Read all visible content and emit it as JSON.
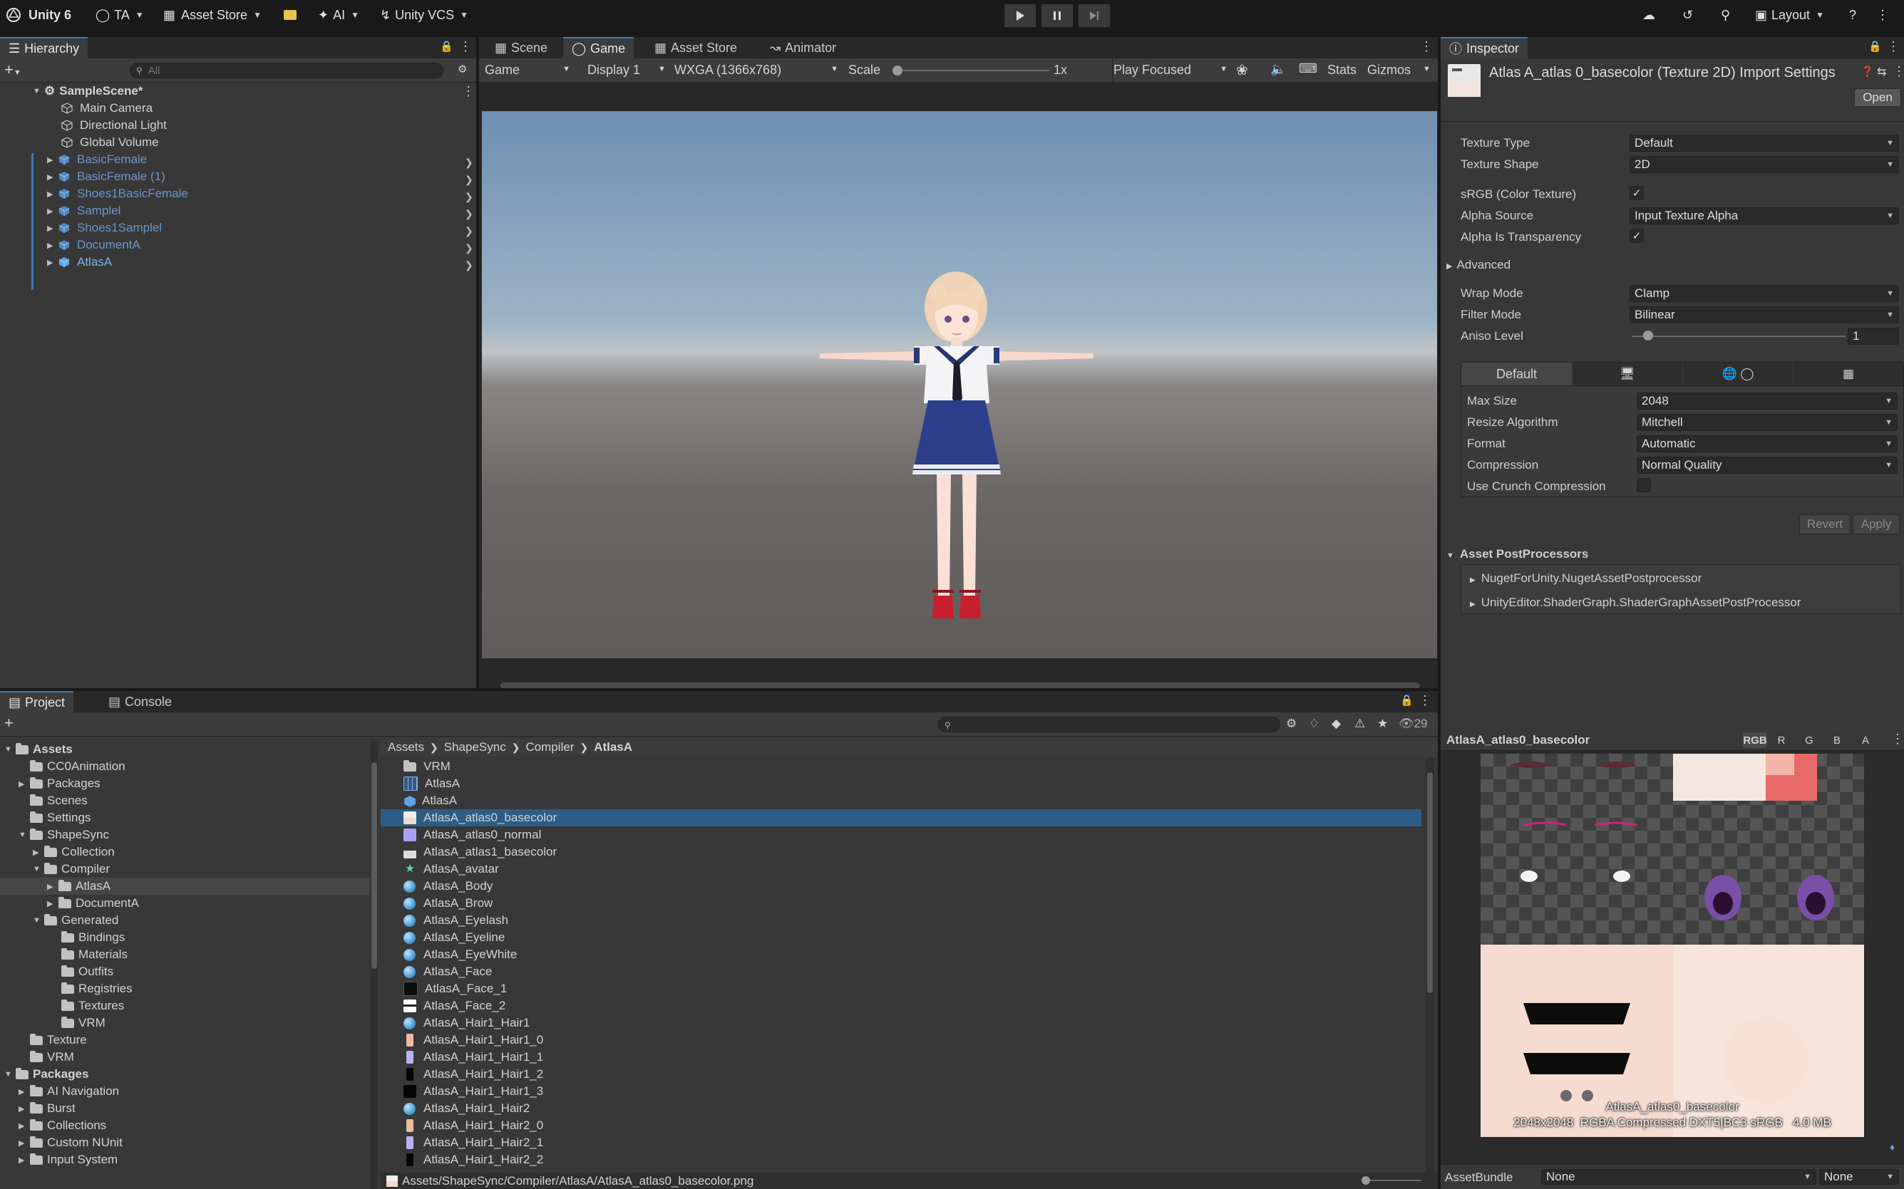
{
  "toolbar": {
    "app_name": "Unity 6",
    "account": "TA",
    "asset_store": "Asset Store",
    "ai": "AI",
    "vcs": "Unity VCS",
    "layout": "Layout"
  },
  "hierarchy": {
    "tab": "Hierarchy",
    "search_placeholder": "All",
    "scene": "SampleScene*",
    "items": [
      "Main Camera",
      "Directional Light",
      "Global Volume",
      "BasicFemale",
      "BasicFemale (1)",
      "Shoes1BasicFemale",
      "Samplel",
      "Shoes1Samplel",
      "DocumentA",
      "AtlasA"
    ]
  },
  "game_view": {
    "tabs": [
      "Scene",
      "Game",
      "Asset Store",
      "Animator"
    ],
    "view_mode": "Game",
    "display": "Display 1",
    "resolution": "WXGA (1366x768)",
    "scale_label": "Scale",
    "scale_value": "1x",
    "play_mode": "Play Focused",
    "stats": "Stats",
    "gizmos": "Gizmos"
  },
  "inspector": {
    "tab": "Inspector",
    "title": "Atlas A_atlas 0_basecolor (Texture 2D) Import Settings",
    "open_button": "Open",
    "fields": {
      "texture_type": {
        "label": "Texture Type",
        "value": "Default"
      },
      "texture_shape": {
        "label": "Texture Shape",
        "value": "2D"
      },
      "srgb": {
        "label": "sRGB (Color Texture)"
      },
      "alpha_source": {
        "label": "Alpha Source",
        "value": "Input Texture Alpha"
      },
      "alpha_transparency": {
        "label": "Alpha Is Transparency"
      },
      "advanced": "Advanced",
      "wrap_mode": {
        "label": "Wrap Mode",
        "value": "Clamp"
      },
      "filter_mode": {
        "label": "Filter Mode",
        "value": "Bilinear"
      },
      "aniso_level": {
        "label": "Aniso Level",
        "value": "1"
      }
    },
    "platform_tab": "Default",
    "platform": {
      "max_size": {
        "label": "Max Size",
        "value": "2048"
      },
      "resize": {
        "label": "Resize Algorithm",
        "value": "Mitchell"
      },
      "format": {
        "label": "Format",
        "value": "Automatic"
      },
      "compression": {
        "label": "Compression",
        "value": "Normal Quality"
      },
      "crunch": {
        "label": "Use Crunch Compression"
      }
    },
    "revert": "Revert",
    "apply": "Apply",
    "postprocessors_title": "Asset PostProcessors",
    "postprocessors": [
      "NugetForUnity.NugetAssetPostprocessor",
      "UnityEditor.ShaderGraph.ShaderGraphAssetPostProcessor"
    ]
  },
  "project": {
    "tabs": [
      "Project",
      "Console"
    ],
    "hidden_count": "29",
    "tree": [
      {
        "label": "Assets",
        "bold": true
      },
      {
        "label": "CC0Animation"
      },
      {
        "label": "Packages"
      },
      {
        "label": "Scenes"
      },
      {
        "label": "Settings"
      },
      {
        "label": "ShapeSync"
      },
      {
        "label": "Collection"
      },
      {
        "label": "Compiler"
      },
      {
        "label": "AtlasA"
      },
      {
        "label": "DocumentA"
      },
      {
        "label": "Generated"
      },
      {
        "label": "Bindings"
      },
      {
        "label": "Materials"
      },
      {
        "label": "Outfits"
      },
      {
        "label": "Registries"
      },
      {
        "label": "Textures"
      },
      {
        "label": "VRM"
      },
      {
        "label": "Texture"
      },
      {
        "label": "VRM"
      },
      {
        "label": "Packages",
        "bold": true
      },
      {
        "label": "AI Navigation"
      },
      {
        "label": "Burst"
      },
      {
        "label": "Collections"
      },
      {
        "label": "Custom NUnit"
      },
      {
        "label": "Input System"
      }
    ],
    "breadcrumb": [
      "Assets",
      "ShapeSync",
      "Compiler",
      "AtlasA"
    ],
    "files": [
      "VRM",
      "AtlasA",
      "AtlasA",
      "AtlasA_atlas0_basecolor",
      "AtlasA_atlas0_normal",
      "AtlasA_atlas1_basecolor",
      "AtlasA_avatar",
      "AtlasA_Body",
      "AtlasA_Brow",
      "AtlasA_Eyelash",
      "AtlasA_Eyeline",
      "AtlasA_EyeWhite",
      "AtlasA_Face",
      "AtlasA_Face_1",
      "AtlasA_Face_2",
      "AtlasA_Hair1_Hair1",
      "AtlasA_Hair1_Hair1_0",
      "AtlasA_Hair1_Hair1_1",
      "AtlasA_Hair1_Hair1_2",
      "AtlasA_Hair1_Hair1_3",
      "AtlasA_Hair1_Hair2",
      "AtlasA_Hair1_Hair2_0",
      "AtlasA_Hair1_Hair2_1",
      "AtlasA_Hair1_Hair2_2"
    ],
    "status_path": "Assets/ShapeSync/Compiler/AtlasA/AtlasA_atlas0_basecolor.png"
  },
  "preview": {
    "title": "AtlasA_atlas0_basecolor",
    "channels": [
      "RGB",
      "R",
      "G",
      "B",
      "A"
    ],
    "caption_name": "AtlasA_atlas0_basecolor",
    "caption_info": "2048x2048  RGBA Compressed DXT5|BC3 sRGB   4.0 MB",
    "assetbundle_label": "AssetBundle",
    "bundle_value": "None",
    "variant_value": "None"
  },
  "colors": {
    "accent": "#3a79bb",
    "selection": "#2c5d87",
    "panel": "#383838",
    "child_blue": "#6d94c8"
  }
}
